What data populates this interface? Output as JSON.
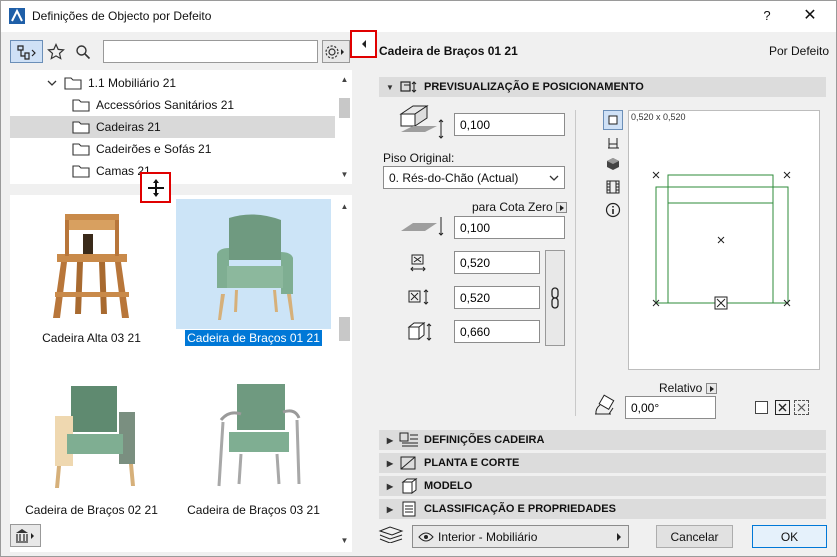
{
  "window": {
    "title": "Definições de Objecto por Defeito",
    "help_label": "?",
    "close_label": "✕"
  },
  "search": {
    "value": "",
    "placeholder": ""
  },
  "tree": {
    "items": [
      {
        "label": "1.1 Mobiliário 21",
        "expanded": true
      },
      {
        "label": "Accessórios Sanitários 21"
      },
      {
        "label": "Cadeiras 21",
        "selected": true
      },
      {
        "label": "Cadeirões e Sofás 21"
      },
      {
        "label": "Camas 21"
      }
    ]
  },
  "gallery": {
    "items": [
      {
        "label": "Cadeira Alta 03 21",
        "icon": "high-chair"
      },
      {
        "label": "Cadeira de Braços 01 21",
        "icon": "armchair-green",
        "selected": true
      },
      {
        "label": "Cadeira de Braços 02 21",
        "icon": "armchair-wood"
      },
      {
        "label": "Cadeira de Braços 03 21",
        "icon": "armchair-metal"
      }
    ]
  },
  "object": {
    "name": "Cadeira de Braços 01 21",
    "default_label": "Por Defeito"
  },
  "sections": {
    "preview": "PREVISUALIZAÇÃO E POSICIONAMENTO",
    "chair": "DEFINIÇÕES CADEIRA",
    "plan": "PLANTA E CORTE",
    "model": "MODELO",
    "classification": "CLASSIFICAÇÃO E PROPRIEDADES"
  },
  "placement": {
    "elevation_value": "0,100",
    "floor_label": "Piso Original:",
    "floor_value": "0. Rés-do-Chão (Actual)",
    "zero_label": "para Cota Zero",
    "zero_value": "0,100",
    "width_value": "0,520",
    "depth_value": "0,520",
    "height_value": "0,660",
    "relative_label": "Relativo",
    "angle_value": "0,00°",
    "preview_size": "0,520 x 0,520"
  },
  "footer": {
    "layer_value": "Interior - Mobiliário",
    "cancel_label": "Cancelar",
    "ok_label": "OK"
  },
  "colors": {
    "accent": "#0078d7",
    "selection": "#cce4f7",
    "highlight_box": "#e00000",
    "preview_line": "#2e8b3a"
  }
}
